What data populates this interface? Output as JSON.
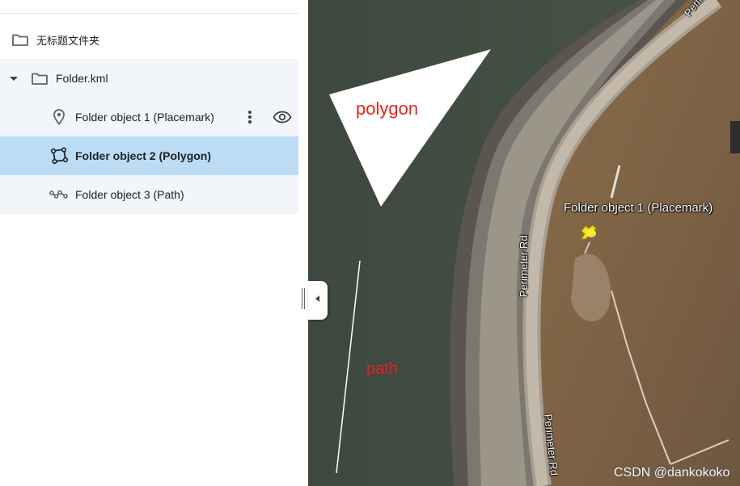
{
  "panel": {
    "root_folder_label": "无标题文件夹",
    "kml_folder_label": "Folder.kml",
    "items": [
      {
        "label": "Folder object 1 (Placemark)",
        "icon": "placemark-icon"
      },
      {
        "label": "Folder object 2 (Polygon)",
        "icon": "polygon-icon",
        "selected": true
      },
      {
        "label": "Folder object 3 (Path)",
        "icon": "path-icon"
      }
    ]
  },
  "map": {
    "annotation_polygon": "polygon",
    "annotation_path": "path",
    "placemark_label": "Folder object 1 (Placemark)",
    "road_label_1": "Perimeter Rd",
    "road_label_2": "Perimeter Rd",
    "road_label_3": "Perim",
    "watermark": "CSDN @dankokoko"
  },
  "colors": {
    "selected_row": "#bcdcf5",
    "row_background": "#f2f5fa",
    "annotation_red": "#e5241b",
    "water": "#3f4a40",
    "pin_yellow": "#f2e21c"
  }
}
